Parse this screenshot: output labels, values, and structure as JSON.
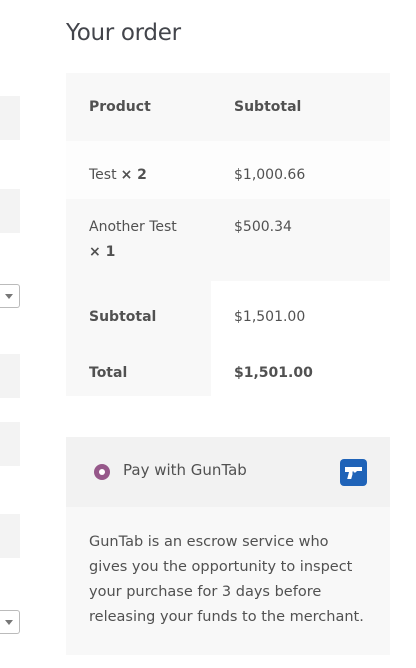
{
  "order": {
    "heading": "Your order",
    "header": {
      "product": "Product",
      "subtotal": "Subtotal"
    },
    "items": [
      {
        "name": "Test",
        "qty": "× 2",
        "subtotal": "$1,000.66"
      },
      {
        "name": "Another Test",
        "qty": "× 1",
        "subtotal": "$500.34"
      }
    ],
    "subtotal": {
      "label": "Subtotal",
      "value": "$1,501.00"
    },
    "total": {
      "label": "Total",
      "value": "$1,501.00"
    }
  },
  "payment": {
    "method_label": "Pay with GunTab",
    "method_icon": "guntab-logo-icon",
    "description": "GunTab is an escrow service who gives you the opportunity to inspect your purchase for 3 days before releasing your funds to the merchant.",
    "accent_color": "#96588a",
    "logo_color": "#1f63b8"
  }
}
